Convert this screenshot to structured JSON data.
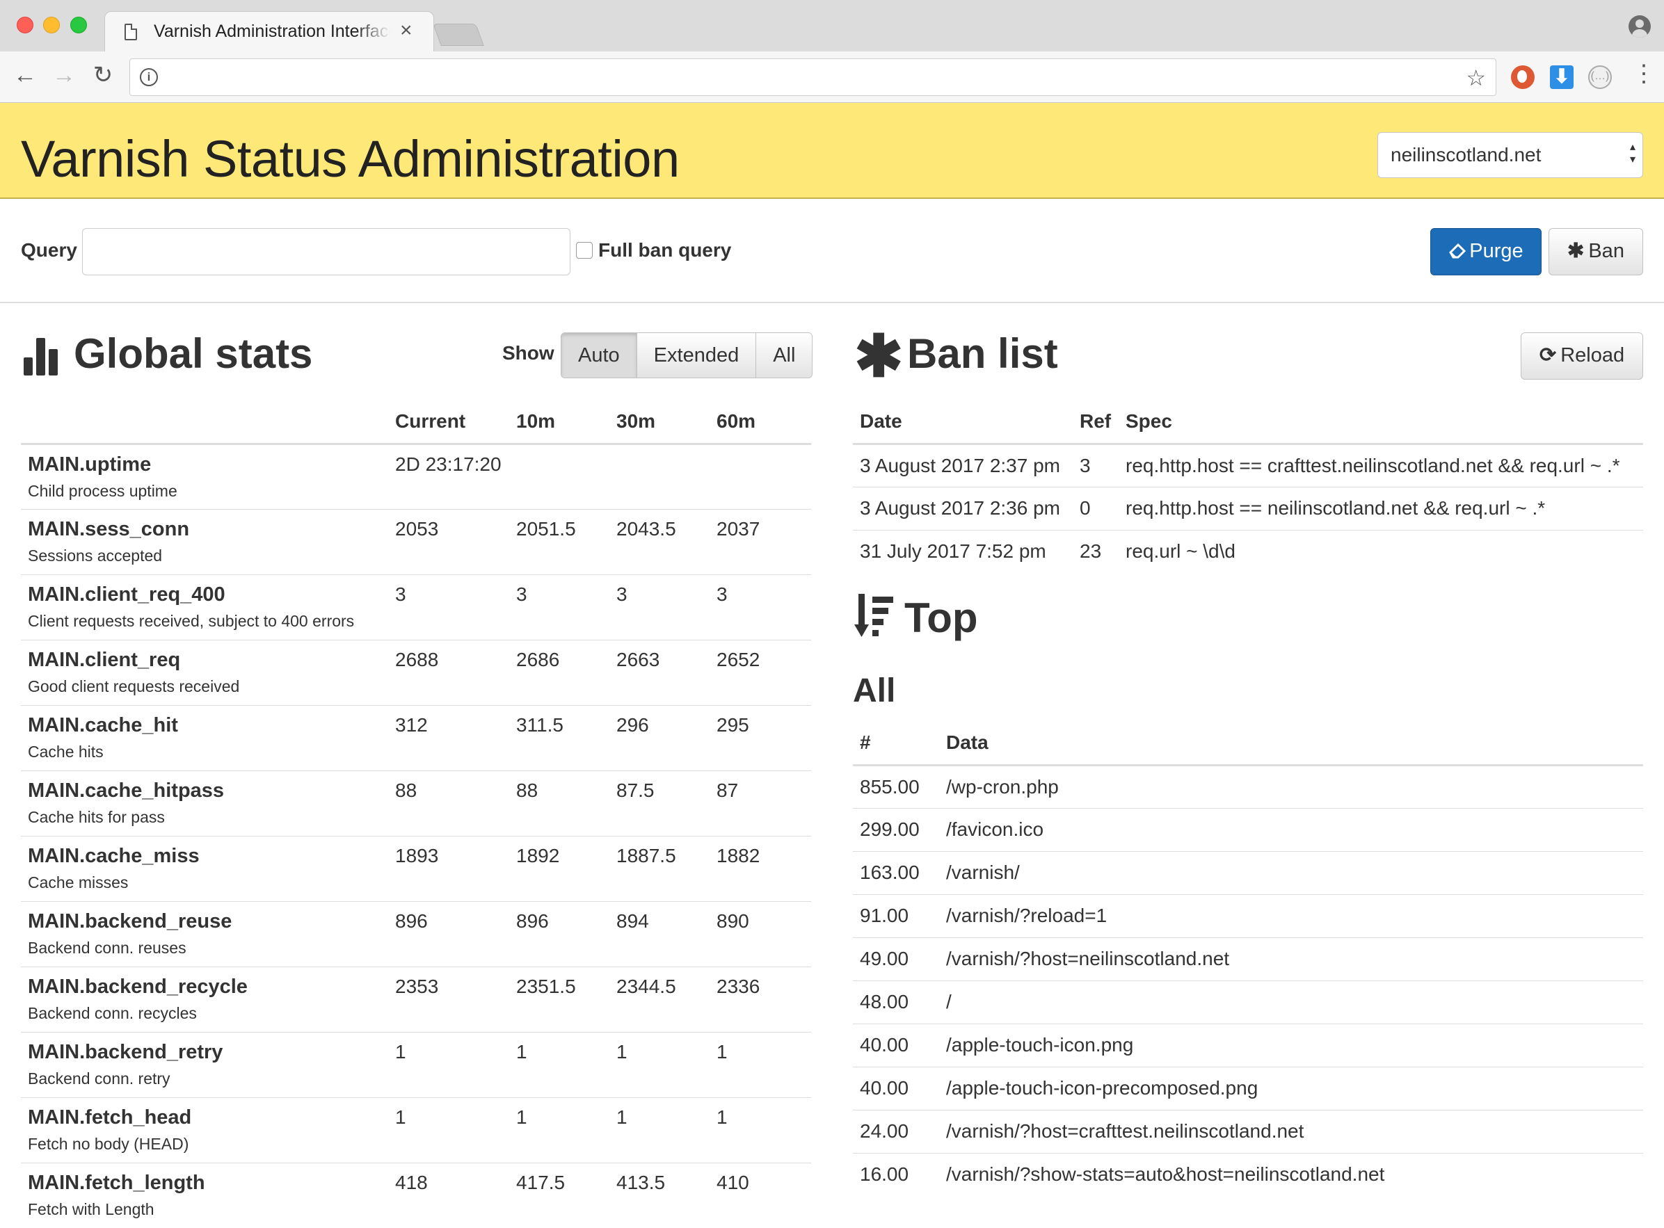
{
  "browser": {
    "tab_title": "Varnish Administration Interface",
    "close_glyph": "×",
    "back_glyph": "←",
    "forward_glyph": "→",
    "reload_glyph": "↻",
    "info_glyph": "i",
    "star_glyph": "☆",
    "download_glyph": "⬇",
    "ext_glyph": "(…)",
    "menu_glyph": "⋮"
  },
  "header": {
    "title": "Varnish Status Administration",
    "host_selected": "neilinscotland.net",
    "select_arrows": "▴\n▾",
    "colors": {
      "background": "#fde878"
    }
  },
  "query": {
    "label": "Query",
    "value": "",
    "full_ban_label": "Full ban query",
    "full_ban_checked": false,
    "purge_label": "Purge",
    "purge_icon": "eraser-icon",
    "ban_label": "Ban",
    "ban_icon": "asterisk-icon",
    "colors": {
      "purge": "#1c6cb8"
    }
  },
  "global_stats": {
    "title": "Global stats",
    "show_label": "Show",
    "modes": [
      "Auto",
      "Extended",
      "All"
    ],
    "active_mode": "Auto",
    "columns": [
      "",
      "Current",
      "10m",
      "30m",
      "60m"
    ],
    "rows": [
      {
        "name": "MAIN.uptime",
        "desc": "Child process uptime",
        "current": "2D 23:17:20",
        "m10": "",
        "m30": "",
        "m60": ""
      },
      {
        "name": "MAIN.sess_conn",
        "desc": "Sessions accepted",
        "current": "2053",
        "m10": "2051.5",
        "m30": "2043.5",
        "m60": "2037"
      },
      {
        "name": "MAIN.client_req_400",
        "desc": "Client requests received, subject to 400 errors",
        "current": "3",
        "m10": "3",
        "m30": "3",
        "m60": "3"
      },
      {
        "name": "MAIN.client_req",
        "desc": "Good client requests received",
        "current": "2688",
        "m10": "2686",
        "m30": "2663",
        "m60": "2652"
      },
      {
        "name": "MAIN.cache_hit",
        "desc": "Cache hits",
        "current": "312",
        "m10": "311.5",
        "m30": "296",
        "m60": "295"
      },
      {
        "name": "MAIN.cache_hitpass",
        "desc": "Cache hits for pass",
        "current": "88",
        "m10": "88",
        "m30": "87.5",
        "m60": "87"
      },
      {
        "name": "MAIN.cache_miss",
        "desc": "Cache misses",
        "current": "1893",
        "m10": "1892",
        "m30": "1887.5",
        "m60": "1882"
      },
      {
        "name": "MAIN.backend_reuse",
        "desc": "Backend conn. reuses",
        "current": "896",
        "m10": "896",
        "m30": "894",
        "m60": "890"
      },
      {
        "name": "MAIN.backend_recycle",
        "desc": "Backend conn. recycles",
        "current": "2353",
        "m10": "2351.5",
        "m30": "2344.5",
        "m60": "2336"
      },
      {
        "name": "MAIN.backend_retry",
        "desc": "Backend conn. retry",
        "current": "1",
        "m10": "1",
        "m30": "1",
        "m60": "1"
      },
      {
        "name": "MAIN.fetch_head",
        "desc": "Fetch no body (HEAD)",
        "current": "1",
        "m10": "1",
        "m30": "1",
        "m60": "1"
      },
      {
        "name": "MAIN.fetch_length",
        "desc": "Fetch with Length",
        "current": "418",
        "m10": "417.5",
        "m30": "413.5",
        "m60": "410"
      }
    ]
  },
  "ban_list": {
    "title": "Ban list",
    "icon_glyph": "✱",
    "reload_label": "Reload",
    "reload_glyph": "⟳",
    "columns": [
      "Date",
      "Ref",
      "Spec"
    ],
    "rows": [
      {
        "date": "3 August 2017 2:37 pm",
        "ref": "3",
        "spec": "req.http.host == crafttest.neilinscotland.net && req.url ~ .*"
      },
      {
        "date": "3 August 2017 2:36 pm",
        "ref": "0",
        "spec": "req.http.host == neilinscotland.net && req.url ~ .*"
      },
      {
        "date": "31 July 2017 7:52 pm",
        "ref": "23",
        "spec": "req.url ~ \\d\\d"
      }
    ]
  },
  "top": {
    "title": "Top",
    "subheading": "All",
    "columns": [
      "#",
      "Data"
    ],
    "rows": [
      {
        "count": "855.00",
        "data": "/wp-cron.php"
      },
      {
        "count": "299.00",
        "data": "/favicon.ico"
      },
      {
        "count": "163.00",
        "data": "/varnish/"
      },
      {
        "count": "91.00",
        "data": "/varnish/?reload=1"
      },
      {
        "count": "49.00",
        "data": "/varnish/?host=neilinscotland.net"
      },
      {
        "count": "48.00",
        "data": "/"
      },
      {
        "count": "40.00",
        "data": "/apple-touch-icon.png"
      },
      {
        "count": "40.00",
        "data": "/apple-touch-icon-precomposed.png"
      },
      {
        "count": "24.00",
        "data": "/varnish/?host=crafttest.neilinscotland.net"
      },
      {
        "count": "16.00",
        "data": "/varnish/?show-stats=auto&host=neilinscotland.net"
      }
    ]
  }
}
